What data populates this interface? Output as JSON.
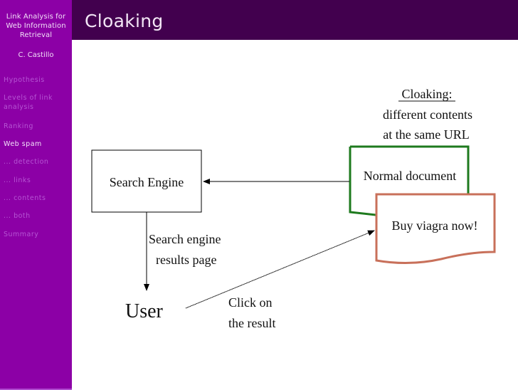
{
  "sidebar": {
    "title_lines": [
      "Link Analysis for",
      "Web Information",
      "Retrieval"
    ],
    "author": "C. Castillo",
    "nav": [
      {
        "label": "Hypothesis",
        "active": false
      },
      {
        "label": "Levels of link",
        "label2": "analysis",
        "active": false
      },
      {
        "label": "Ranking",
        "active": false
      },
      {
        "label": "Web spam",
        "active": true
      },
      {
        "label": "... detection",
        "active": false
      },
      {
        "label": "... links",
        "active": false
      },
      {
        "label": "... contents",
        "active": false
      },
      {
        "label": "... both",
        "active": false
      },
      {
        "label": "Summary",
        "active": false
      }
    ]
  },
  "header": {
    "title": "Cloaking"
  },
  "diagram": {
    "caption": [
      "Cloaking:",
      "different contents",
      "at the same URL"
    ],
    "search_engine": "Search Engine",
    "normal_document": "Normal document",
    "spam_document": "Buy viagra now!",
    "serp_label": [
      "Search engine",
      "results page"
    ],
    "user": "User",
    "click_label": [
      "Click on",
      "the result"
    ],
    "colors": {
      "normal_doc_border": "#1e7a1e",
      "spam_doc_border": "#c8705a"
    }
  }
}
